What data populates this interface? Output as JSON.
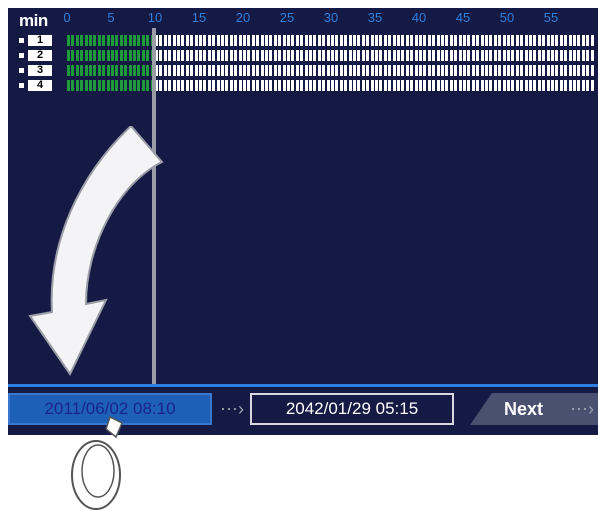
{
  "timeline": {
    "unit_label": "min",
    "ticks": [
      "0",
      "5",
      "10",
      "15",
      "20",
      "25",
      "30",
      "35",
      "40",
      "45",
      "50",
      "55"
    ],
    "channels": [
      {
        "label": "1",
        "recorded_minutes": 10
      },
      {
        "label": "2",
        "recorded_minutes": 10
      },
      {
        "label": "3",
        "recorded_minutes": 10
      },
      {
        "label": "4",
        "recorded_minutes": 10
      }
    ],
    "cursor_minute": 10,
    "colors": {
      "recorded": "#1f9a3a",
      "empty": "#ffffff",
      "background": "#141a44",
      "tick_text": "#2f7fe0"
    }
  },
  "search_bar": {
    "start_time": "2011/06/02 08:10",
    "end_time": "2042/01/29 05:15",
    "separator_icon": "dotted-arrow-right-icon",
    "next_label": "Next",
    "next_icon": "dotted-arrow-right-icon"
  },
  "overlay": {
    "arrow_icon": "curved-arrow-down-icon",
    "hand_icon": "finger-tap-icon"
  }
}
